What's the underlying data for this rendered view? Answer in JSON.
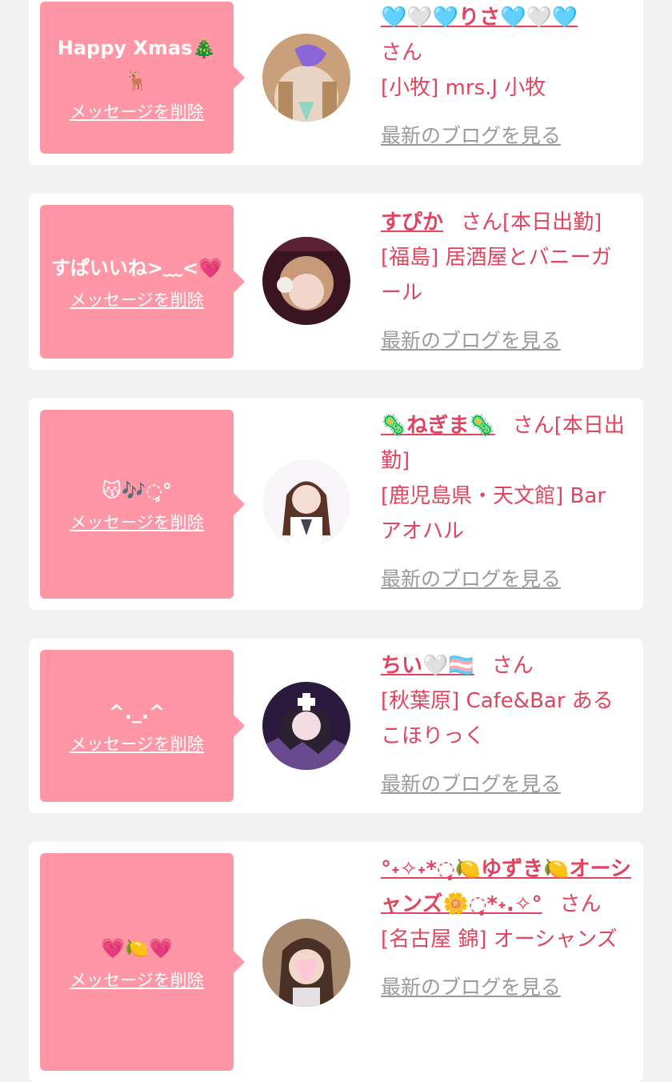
{
  "delete_label": "メッセージを削除",
  "blog_label": "最新のブログを見る",
  "colors": {
    "accent": "#e0445f",
    "bubble": "#ff96a6",
    "link_gray": "#9a9a9a",
    "background": "#f2f2f2"
  },
  "entries": [
    {
      "message": "Happy Xmas🎄🦌",
      "name": "🩵🤍🩵りさ🩵🤍🩵",
      "san": "さん",
      "shop": "[小牧] mrs.J 小牧"
    },
    {
      "message": "すぱいいね>﹏<💗",
      "name": "すぴか",
      "san": "さん[本日出勤]",
      "shop": "[福島] 居酒屋とバニーガール"
    },
    {
      "message": "😽🎶◌̥°",
      "name": "🦠ねぎま🦠",
      "san": "さん[本日出勤]",
      "shop": "[鹿児島県・天文館] Bar アオハル"
    },
    {
      "message": "^._.^",
      "name": "ちい🤍🏳️‍⚧️",
      "san": "さん",
      "shop": "[秋葉原] Cafe&Bar あるこほりっく"
    },
    {
      "message": "💗🍋💗",
      "name": "°˖✧˖*◌̥🍋ゆずき🍋オーシャンズ🌼◌̥*˖.✧°",
      "san": "さん",
      "shop": "[名古屋 錦] オーシャンズ"
    }
  ]
}
